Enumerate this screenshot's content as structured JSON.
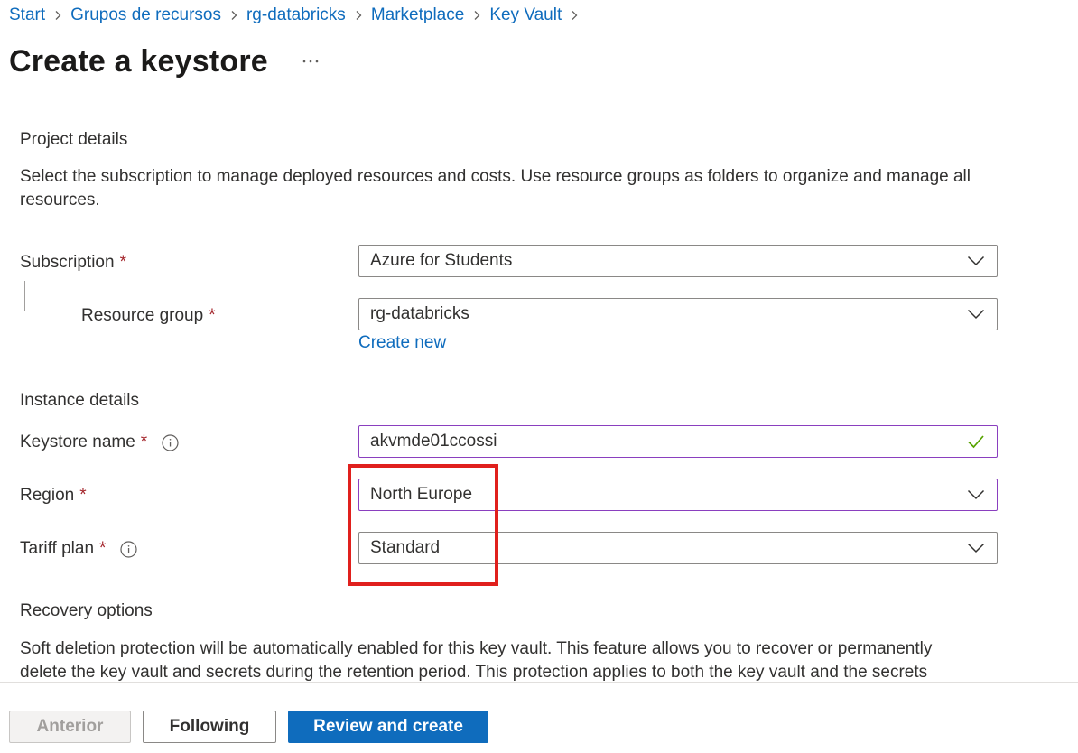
{
  "breadcrumb": {
    "items": [
      "Start",
      "Grupos de recursos",
      "rg-databricks",
      "Marketplace",
      "Key Vault"
    ]
  },
  "page": {
    "title": "Create a keystore",
    "more_label": "..."
  },
  "project_details": {
    "heading": "Project details",
    "description": "Select the subscription to manage deployed resources and costs. Use resource groups as folders to organize and manage all resources.",
    "subscription": {
      "label": "Subscription",
      "required_mark": "*",
      "value": "Azure for Students"
    },
    "resource_group": {
      "label": "Resource group",
      "required_mark": "*",
      "value": "rg-databricks",
      "create_new_link": "Create new"
    }
  },
  "instance_details": {
    "heading": "Instance details",
    "keystore_name": {
      "label": "Keystore name",
      "required_mark": "*",
      "value": "akvmde01ccossi",
      "valid": true
    },
    "region": {
      "label": "Region",
      "required_mark": "*",
      "value": "North Europe"
    },
    "tariff_plan": {
      "label": "Tariff plan",
      "required_mark": "*",
      "value": "Standard"
    }
  },
  "recovery_options": {
    "heading": "Recovery options",
    "description": "Soft deletion protection will be automatically enabled for this key vault. This feature allows you to recover or permanently delete the key vault and secrets during the retention period. This protection applies to both the key vault and the secrets"
  },
  "footer": {
    "previous_label": "Anterior",
    "next_label": "Following",
    "review_label": "Review and create"
  },
  "colors": {
    "accent": "#0f6cbd",
    "required": "#a4262c",
    "focus_border": "#8a3fbf",
    "highlight": "#e0201d",
    "valid_check": "#57a300"
  },
  "icons": {
    "breadcrumb_separator": "chevron-right-icon",
    "dropdown": "chevron-down-icon",
    "info": "info-icon",
    "valid": "checkmark-icon",
    "more": "more-icon"
  }
}
